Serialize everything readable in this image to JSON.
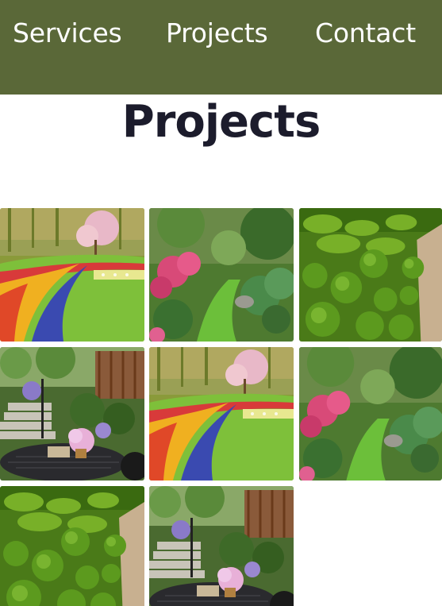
{
  "nav": {
    "items": [
      {
        "label": "Services"
      },
      {
        "label": "Projects"
      },
      {
        "label": "Contact"
      }
    ]
  },
  "page": {
    "title": "Projects"
  },
  "colors": {
    "nav_bg": "#5a6838",
    "title": "#1c1c2c",
    "background": "#ffffff"
  },
  "gallery": {
    "items": [
      {
        "scene": "tulip-garden"
      },
      {
        "scene": "woodland-path"
      },
      {
        "scene": "topiary-garden"
      },
      {
        "scene": "patio-stairs"
      },
      {
        "scene": "tulip-garden"
      },
      {
        "scene": "woodland-path"
      },
      {
        "scene": "topiary-garden"
      },
      {
        "scene": "patio-stairs"
      }
    ]
  }
}
